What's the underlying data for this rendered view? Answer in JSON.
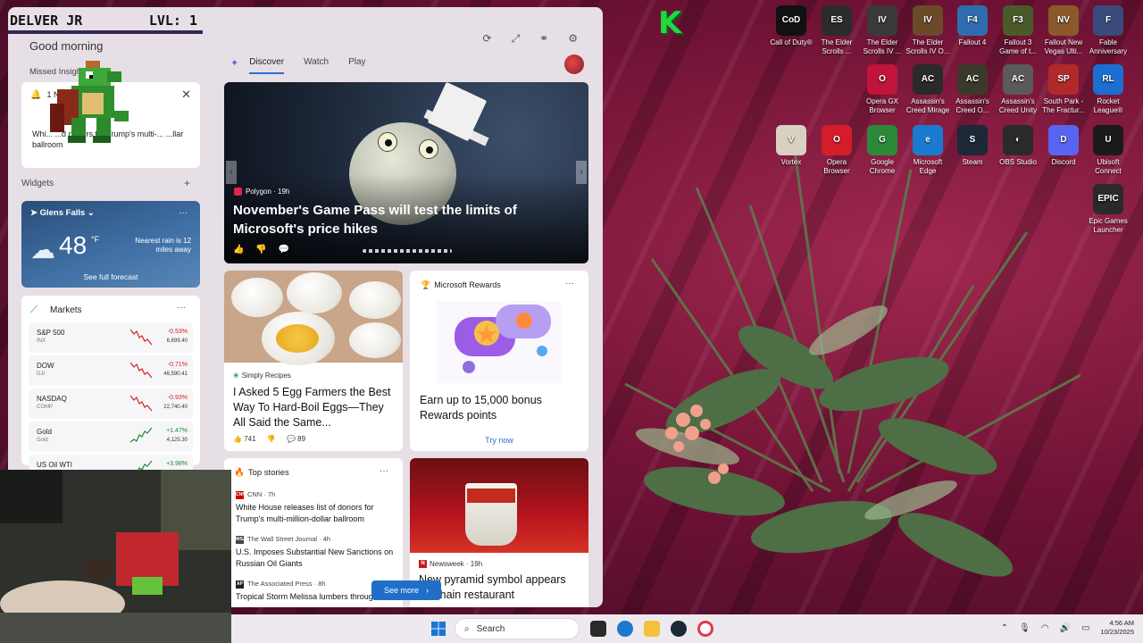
{
  "overlay": {
    "streamer_name": "DELVER JR",
    "level": "LVL: 1"
  },
  "panel": {
    "greeting": "Good morning",
    "header_icons": [
      "refresh-icon",
      "expand-icon",
      "link-icon",
      "settings-icon"
    ],
    "missed_insights_label": "Missed Insights",
    "insight": {
      "notification": "1 Notifi",
      "body": "Whi... ...d donors for Trump's multi-... ...llar ballroom"
    },
    "widgets_label": "Widgets",
    "widgets_add": "+",
    "weather": {
      "location": "Glens Falls",
      "temp": "48",
      "unit": "°F",
      "detail": "Nearest rain is 12 miles away",
      "forecast_link": "See full forecast"
    },
    "markets": {
      "title": "Markets",
      "rows": [
        {
          "symbol": "S&P 500",
          "exchange": "INX",
          "change": "-0.53%",
          "price": "6,699.40",
          "trend": "down"
        },
        {
          "symbol": "DOW",
          "exchange": "DJI",
          "change": "-0.71%",
          "price": "46,590.41",
          "trend": "down"
        },
        {
          "symbol": "NASDAQ",
          "exchange": "COMP",
          "change": "-0.93%",
          "price": "22,740.40",
          "trend": "down"
        },
        {
          "symbol": "Gold",
          "exchange": "Gold",
          "change": "+1.47%",
          "price": "4,125.30",
          "trend": "up"
        },
        {
          "symbol": "US Oil WTI",
          "exchange": "",
          "change": "+3.98%",
          "price": "",
          "trend": "up"
        }
      ]
    },
    "tabs": [
      "Discover",
      "Watch",
      "Play"
    ],
    "hero": {
      "source": "Polygon · 19h",
      "headline": "November's Game Pass will test the limits of Microsoft's price hikes"
    },
    "egg_card": {
      "source": "Simply Recipes",
      "headline": "I Asked 5 Egg Farmers the Best Way To Hard-Boil Eggs—They All Said the Same...",
      "likes": "741",
      "comments": "89"
    },
    "rewards_card": {
      "title": "Microsoft Rewards",
      "headline": "Earn up to 15,000 bonus Rewards points",
      "cta": "Try now"
    },
    "top_stories": {
      "title": "Top stories",
      "items": [
        {
          "badge": "CNN",
          "source": "CNN · 7h",
          "title": "White House releases list of donors for Trump's multi-million-dollar ballroom"
        },
        {
          "badge": "WSJ",
          "source": "The Wall Street Journal · 4h",
          "title": "U.S. Imposes Substantial New Sanctions on Russian Oil Giants"
        },
        {
          "badge": "AP",
          "source": "The Associated Press · 8h",
          "title": "Tropical Storm Melissa lumbers through"
        }
      ],
      "see_more": "See more"
    },
    "newsweek_card": {
      "source": "Newsweek · 19h",
      "headline": "New pyramid symbol appears on chain restaurant"
    }
  },
  "desktop_icons": [
    {
      "label": "Call of Duty®",
      "color": "#111111",
      "glyph": "CoD"
    },
    {
      "label": "The Elder Scrolls ...",
      "color": "#2b2b2b",
      "glyph": "ES"
    },
    {
      "label": "The Elder Scrolls IV ...",
      "color": "#3a3a3a",
      "glyph": "IV"
    },
    {
      "label": "The Elder Scrolls IV O...",
      "color": "#6b4a2a",
      "glyph": "IV"
    },
    {
      "label": "Fallout 4",
      "color": "#2f6db0",
      "glyph": "F4"
    },
    {
      "label": "Fallout 3 Game of t...",
      "color": "#4a5a2a",
      "glyph": "F3"
    },
    {
      "label": "Fallout New Vegas Ulti...",
      "color": "#8a5a2a",
      "glyph": "NV"
    },
    {
      "label": "Fable Anniversary",
      "color": "#3a4a7a",
      "glyph": "F"
    },
    {
      "label": "Opera GX Browser",
      "color": "#c0143c",
      "glyph": "O"
    },
    {
      "label": "Assassin's Creed Mirage",
      "color": "#2a2a2a",
      "glyph": "AC"
    },
    {
      "label": "Assassin's Creed O...",
      "color": "#3a3a2a",
      "glyph": "AC"
    },
    {
      "label": "Assassin's Creed Unity",
      "color": "#5a5a5a",
      "glyph": "AC"
    },
    {
      "label": "South Park - The Fractur...",
      "color": "#b02a2a",
      "glyph": "SP"
    },
    {
      "label": "Rocket League®",
      "color": "#1a6fd0",
      "glyph": "RL"
    },
    {
      "label": "Vortex",
      "color": "#d8d0c0",
      "glyph": "V"
    },
    {
      "label": "Opera Browser",
      "color": "#d41c2a",
      "glyph": "O"
    },
    {
      "label": "Google Chrome",
      "color": "#2a8a3a",
      "glyph": "G"
    },
    {
      "label": "Microsoft Edge",
      "color": "#1a7ad0",
      "glyph": "e"
    },
    {
      "label": "Steam",
      "color": "#1b2838",
      "glyph": "S"
    },
    {
      "label": "OBS Studio",
      "color": "#2a2a2a",
      "glyph": "◐"
    },
    {
      "label": "Discord",
      "color": "#5865f2",
      "glyph": "D"
    },
    {
      "label": "Ubisoft Connect",
      "color": "#1a1a1a",
      "glyph": "U"
    },
    {
      "label": "Epic Games Launcher",
      "color": "#2a2a2a",
      "glyph": "EPIC"
    }
  ],
  "desktop_logo": "K",
  "taskbar": {
    "search_placeholder": "Search",
    "time": "4:56 AM",
    "date": "10/23/2025"
  },
  "colors": {
    "accent": "#1f6fc9",
    "panel_bg": "#e7dfe6",
    "wallpaper": "#6e1438",
    "negative": "#d12020",
    "positive": "#1a8a30"
  }
}
